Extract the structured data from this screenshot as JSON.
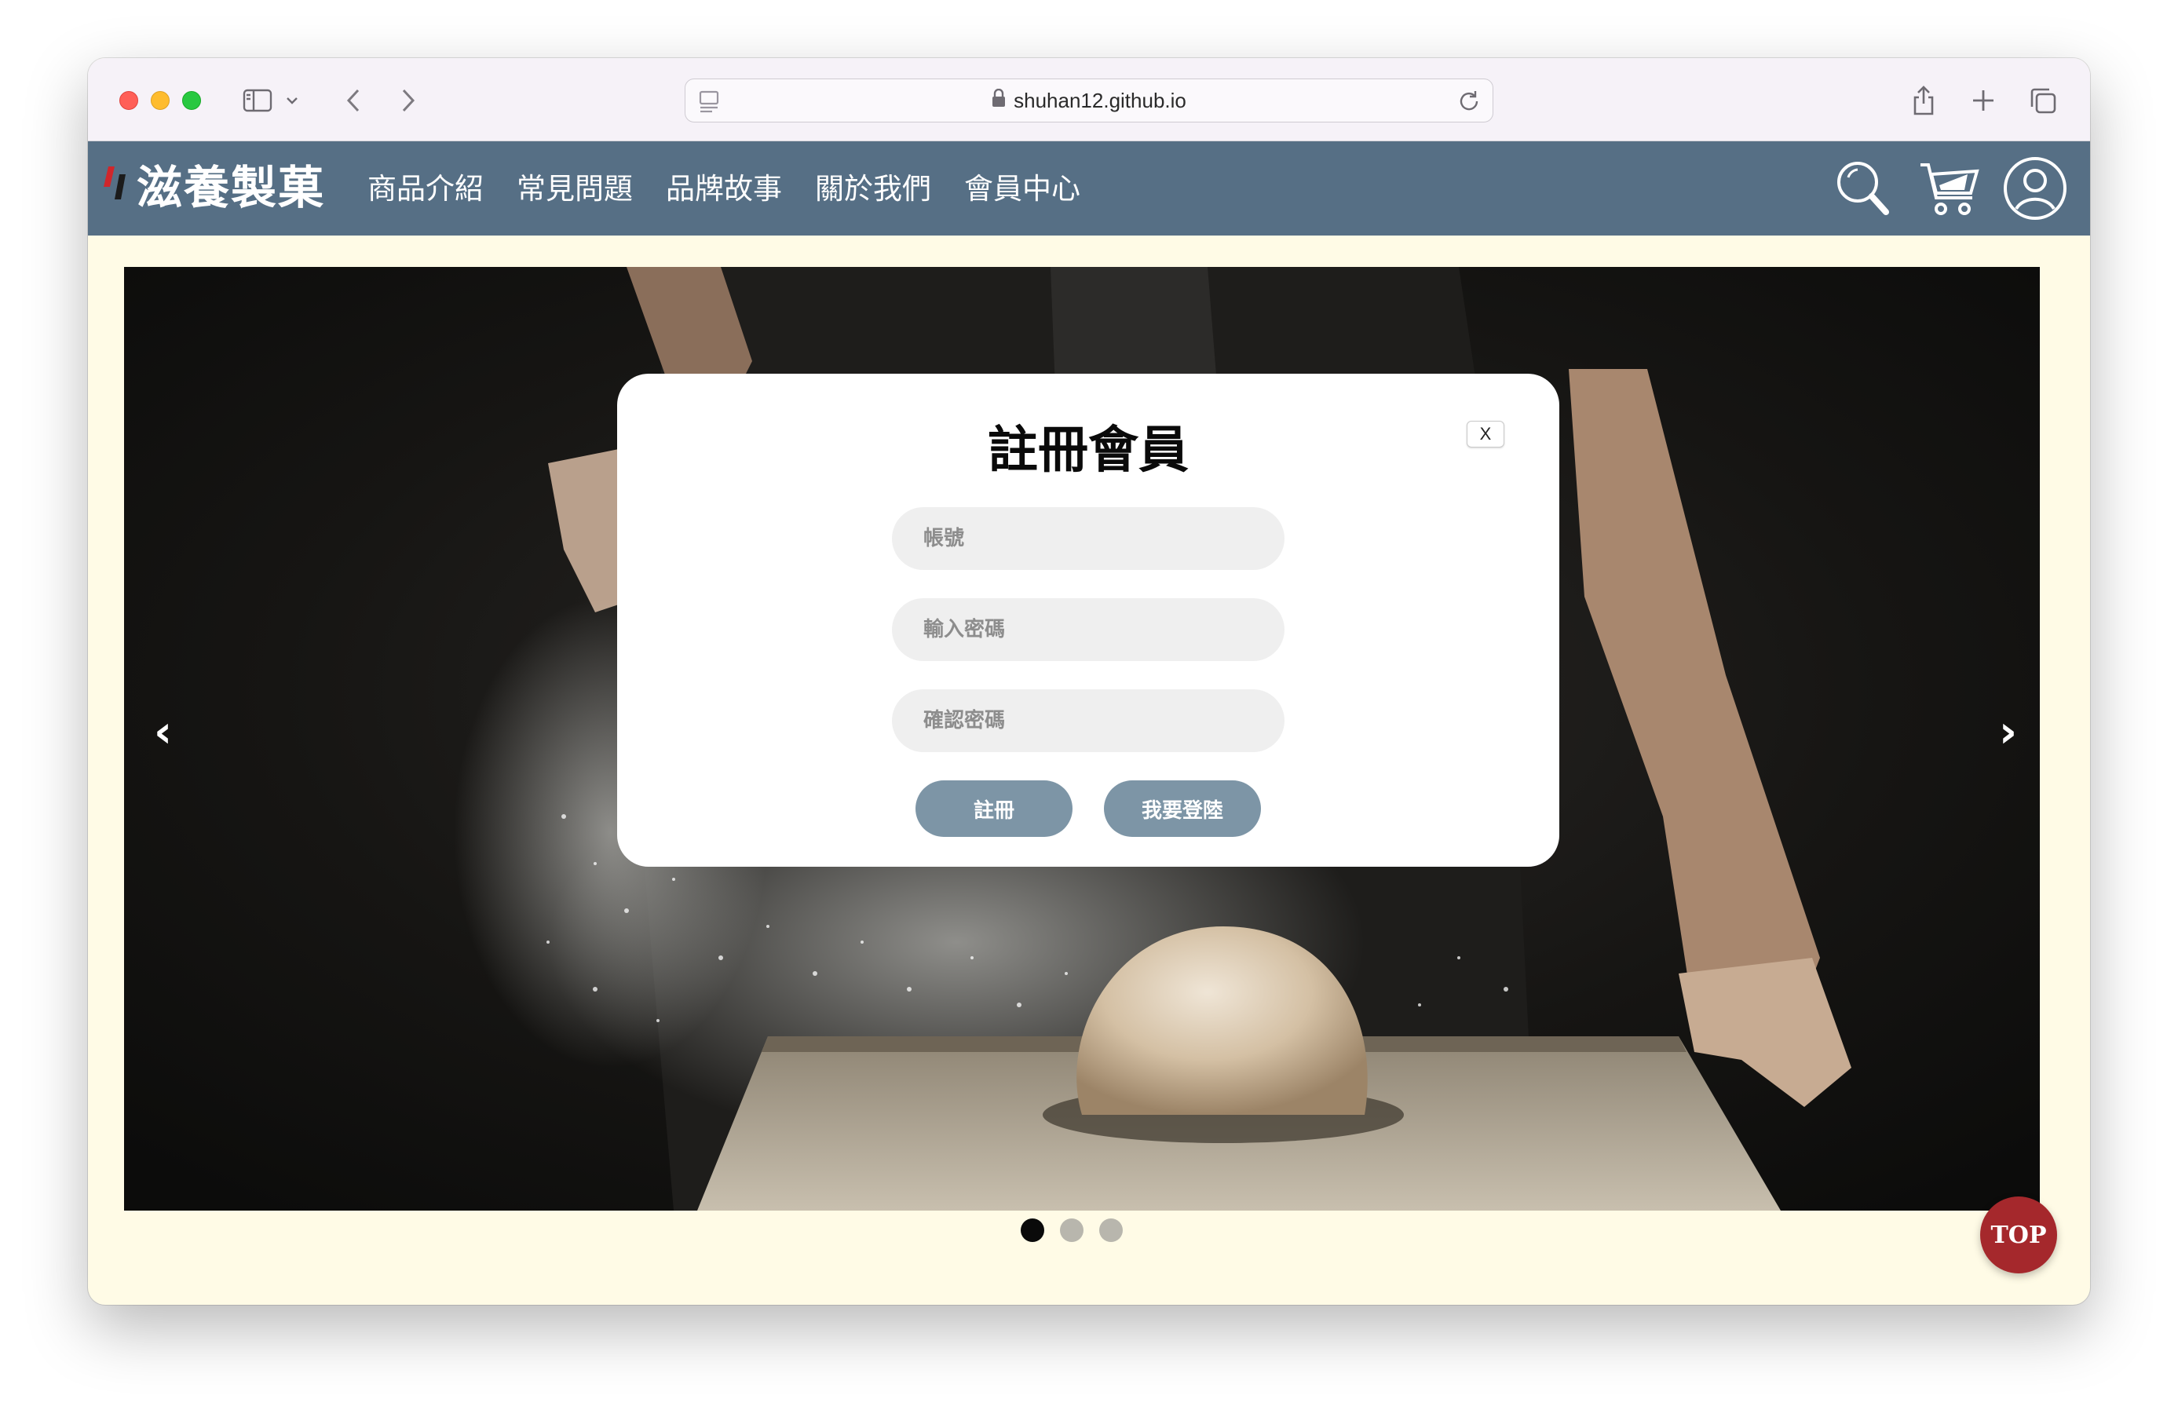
{
  "browser": {
    "url": "shuhan12.github.io"
  },
  "site": {
    "logo_text": "滋養製菓",
    "nav": [
      "商品介紹",
      "常見問題",
      "品牌故事",
      "關於我們",
      "會員中心"
    ],
    "icons": [
      "search-icon",
      "cart-icon",
      "user-icon"
    ]
  },
  "carousel": {
    "prev_label": "‹",
    "next_label": "›",
    "slide_count": 3,
    "active_slide": 1
  },
  "modal": {
    "title": "註冊會員",
    "close_label": "X",
    "account_placeholder": "帳號",
    "password_placeholder": "輸入密碼",
    "confirm_placeholder": "確認密碼",
    "register_label": "註冊",
    "login_label": "我要登陸"
  },
  "top_button": "TOP",
  "colors": {
    "header": "#566f85",
    "page_background": "#fffbe6",
    "modal_button": "#7d95a6",
    "top_button": "#a5282c"
  }
}
